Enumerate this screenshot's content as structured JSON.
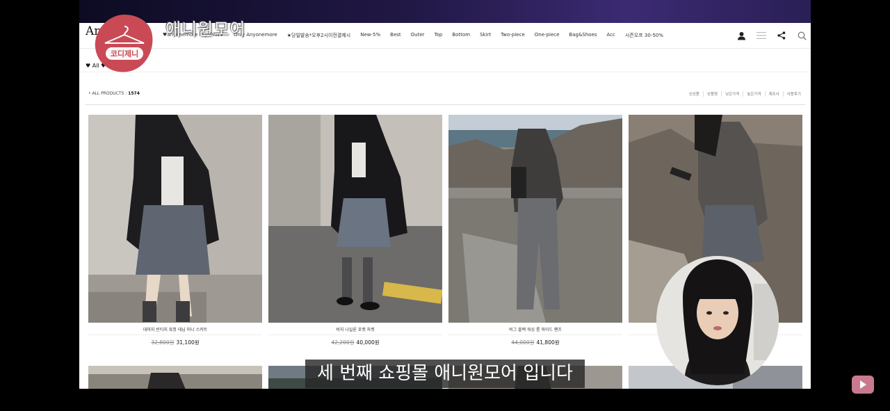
{
  "site": {
    "logo": "Am",
    "menu": [
      "♥anyonemore in JAPAN♥",
      "Only Anyonemore",
      "★당일발송*오후2시이전결제시",
      "New-5%",
      "Best",
      "Outer",
      "Top",
      "Bottom",
      "Skirt",
      "Two-piece",
      "One-piece",
      "Bag&Shoes",
      "Acc",
      "시즌오프 30-50%"
    ],
    "subnav": "♥ All ♥",
    "count_label": "• ALL PRODUCTS : ",
    "count_value": "1574",
    "sorts": [
      "신상품",
      "상품명",
      "낮은가격",
      "높은가격",
      "제조사",
      "사용후기"
    ]
  },
  "products": [
    {
      "name": "데미지 빈티지 흑청 데님 미니 스커트",
      "old_price": "32,800원",
      "price": "31,100원"
    },
    {
      "name": "비지 나일론 포켓 자켓",
      "old_price": "42,200원",
      "price": "40,000원"
    },
    {
      "name": "비그 블랙 워싱 롱 와이드 팬츠",
      "old_price": "44,000원",
      "price": "41,800원"
    },
    {
      "name": "",
      "old_price": "",
      "price": ""
    }
  ],
  "overlay": {
    "badge_text": "코디제니",
    "channel_title": "애니원모어",
    "subtitle": "세 번째 쇼핑몰 애니원모어 입니다"
  },
  "colors": {
    "badge": "#c94a55",
    "top_bar": "#2a1f55"
  }
}
